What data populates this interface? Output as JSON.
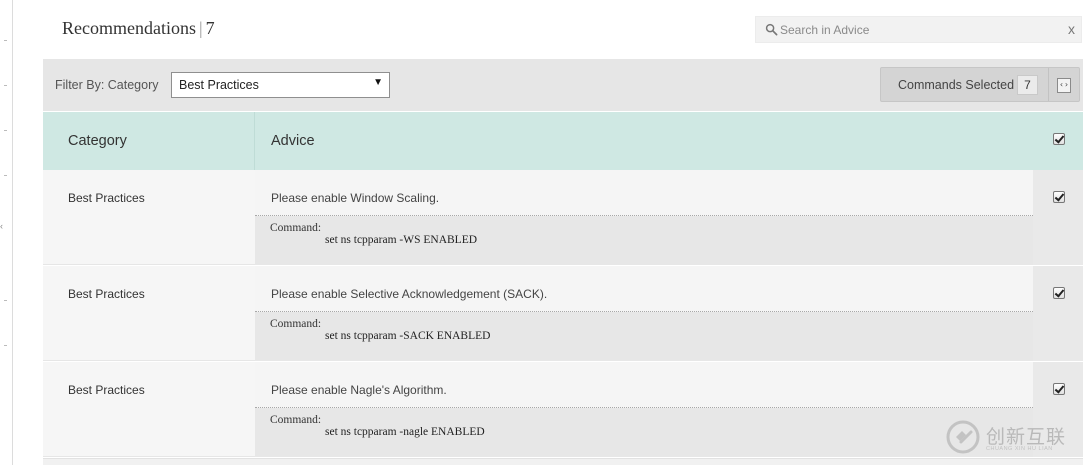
{
  "header": {
    "title": "Recommendations",
    "separator": "|",
    "count": "7"
  },
  "search": {
    "placeholder": "Search in Advice",
    "clear_label": "x",
    "icon": "search-icon"
  },
  "filter": {
    "label": "Filter By: Category",
    "selected": "Best Practices",
    "caret": "▼"
  },
  "commands_selected": {
    "label": "Commands Selected",
    "count": "7",
    "icon": "code-icon",
    "icon_glyph": "‹›"
  },
  "table": {
    "columns": {
      "category": "Category",
      "advice": "Advice"
    },
    "header_checked": true,
    "command_label": "Command:",
    "rows": [
      {
        "category": "Best Practices",
        "advice": "Please enable Window Scaling.",
        "command": "set ns tcpparam -WS ENABLED",
        "checked": true
      },
      {
        "category": "Best Practices",
        "advice": "Please enable Selective Acknowledgement (SACK).",
        "command": "set ns tcpparam -SACK ENABLED",
        "checked": true
      },
      {
        "category": "Best Practices",
        "advice": "Please enable Nagle's Algorithm.",
        "command": "set ns tcpparam -nagle ENABLED",
        "checked": true
      }
    ]
  },
  "watermark": {
    "text": "创新互联",
    "subtext": "CHUANG XIN HU LIAN",
    "icon": "brand-logo-icon"
  },
  "colors": {
    "header_row": "#cfe8e3",
    "filter_bar": "#e6e6e6",
    "command_bg": "#e7e7e7"
  }
}
